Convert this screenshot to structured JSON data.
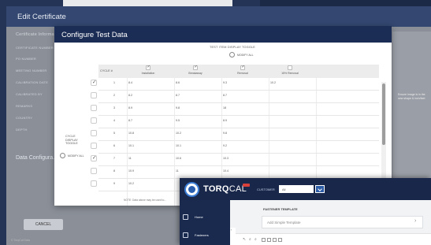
{
  "background": {
    "edit_window_title": "Edit Certificate",
    "sidebar_labels": [
      "Certificate Informa...",
      "CERTIFICATE NUMBER",
      "PO NUMBER",
      "MEETING NUMBER",
      "CALIBRATION DATE",
      "CALIBRATED BY",
      "REMARKS",
      "COUNTRY",
      "DEPTH"
    ],
    "data_config_label": "Data Configura...",
    "right_panel_text": "Ensure image is in the new shape & inch/feet",
    "cancel_label": "CANCEL",
    "footer_text": "© TorqCal Data"
  },
  "modal": {
    "title": "Configure Test Data",
    "test_item_toggle_title": "TEST ITEM DISPLAY TOGGLE",
    "test_item_toggle_all": "MODIFY ALL",
    "cycle_toggle_title": "CYCLE DISPLAY TOGGLE",
    "cycle_toggle_all": "MODIFY ALL",
    "cycle_column_header": "CYCLE #",
    "columns": [
      {
        "label": "Installation",
        "checked": true
      },
      {
        "label": "Breakaway",
        "checked": true
      },
      {
        "label": "Removal",
        "checked": true
      },
      {
        "label": "15% Removal",
        "checked": false
      }
    ],
    "rows": [
      {
        "cycle": "1",
        "checked": true,
        "values": [
          "8.4",
          "8.6",
          "9.3",
          "10.2"
        ]
      },
      {
        "cycle": "2",
        "checked": false,
        "values": [
          "8.2",
          "8.7",
          "8.7",
          ""
        ]
      },
      {
        "cycle": "3",
        "checked": false,
        "values": [
          "8.9",
          "9.8",
          "18",
          ""
        ]
      },
      {
        "cycle": "4",
        "checked": false,
        "values": [
          "8.7",
          "9.5",
          "8.9",
          ""
        ]
      },
      {
        "cycle": "5",
        "checked": false,
        "values": [
          "10.8",
          "10.2",
          "9.8",
          ""
        ]
      },
      {
        "cycle": "6",
        "checked": false,
        "values": [
          "10.1",
          "10.1",
          "9.2",
          ""
        ]
      },
      {
        "cycle": "7",
        "checked": true,
        "values": [
          "11",
          "10.6",
          "10.3",
          ""
        ]
      },
      {
        "cycle": "8",
        "checked": false,
        "values": [
          "10.9",
          "11",
          "10.4",
          ""
        ]
      },
      {
        "cycle": "9",
        "checked": false,
        "values": [
          "10.2",
          "",
          "",
          ""
        ]
      }
    ],
    "note": "NOTE: Data above may be used to..."
  },
  "torqcal": {
    "logo_main": "TORQ",
    "logo_sub": "CAL",
    "customer_label": "CUSTOMER",
    "customer_value": "All",
    "nav_items": [
      {
        "label": "Home",
        "icon": "home-icon"
      },
      {
        "label": "Fasteners",
        "icon": "fastener-icon"
      }
    ],
    "section_label": "FASTENER TEMPLATE",
    "template_placeholder": "Add Simple Template",
    "back_label": "‹"
  },
  "colors": {
    "modal_header": "#1c2d55",
    "app_bar": "#18274a",
    "accent": "#2d5ca6"
  }
}
